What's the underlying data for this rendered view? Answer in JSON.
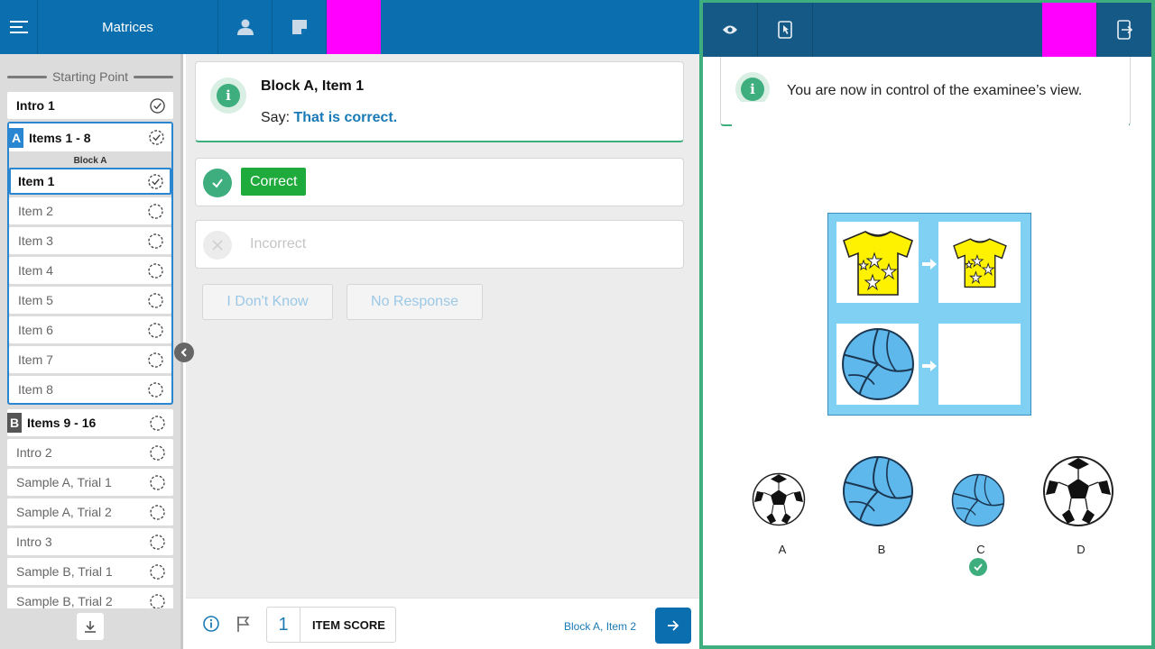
{
  "topbar": {
    "title": "Matrices",
    "icons": [
      "menu-icon",
      "person-icon",
      "note-icon"
    ],
    "accent_color": "#0b6eae",
    "marker_color": "#ff00ff"
  },
  "sidebar": {
    "start_label": "Starting Point",
    "intro1": "Intro 1",
    "block_a": {
      "letter": "A",
      "label": "Items 1 - 8",
      "sub": "Block A",
      "items": [
        "Item 1",
        "Item 2",
        "Item 3",
        "Item 4",
        "Item 5",
        "Item 6",
        "Item 7",
        "Item 8"
      ],
      "selected": "Item 1"
    },
    "block_b": {
      "letter": "B",
      "label": "Items 9 - 16"
    },
    "rest": [
      "Intro 2",
      "Sample A, Trial 1",
      "Sample A, Trial 2",
      "Intro 3",
      "Sample B, Trial 1",
      "Sample B, Trial 2"
    ]
  },
  "main": {
    "info": {
      "title": "Block A, Item 1",
      "say_prefix": "Say:",
      "say_text": "That is correct."
    },
    "responses": {
      "correct": "Correct",
      "incorrect": "Incorrect",
      "dont_know": "I Don't Know",
      "no_response": "No Response"
    },
    "footer": {
      "score": "1",
      "score_label": "ITEM SCORE",
      "next_label": "Block A, Item 2"
    }
  },
  "examinee": {
    "notice": "You are now in control of the examinee’s view.",
    "icons": [
      "eye-icon",
      "tablet-pointer-icon",
      "exit-tablet-icon"
    ],
    "options": [
      "A",
      "B",
      "C",
      "D"
    ],
    "selected_option": "C",
    "frame_color": "#3fae7e"
  }
}
